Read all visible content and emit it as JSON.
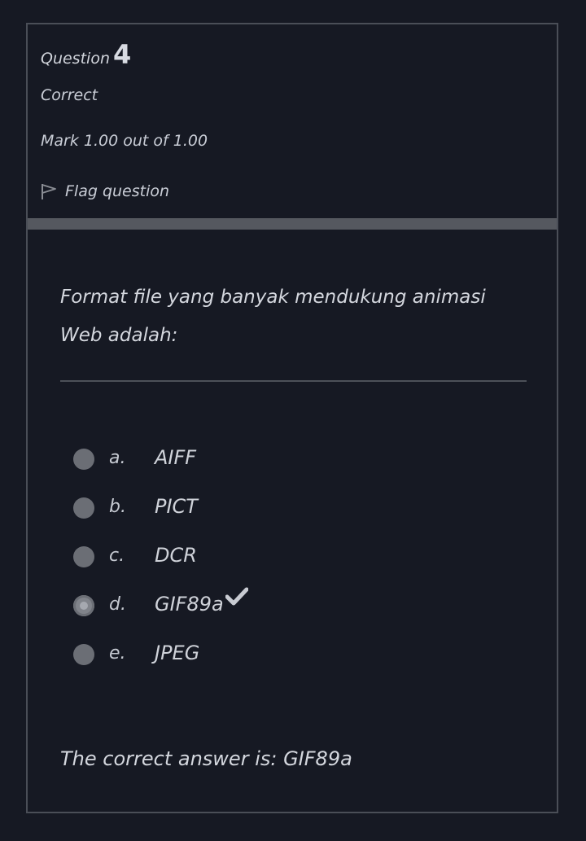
{
  "question": {
    "label": "Question",
    "number": "4",
    "state": "Correct",
    "grade": "Mark 1.00 out of 1.00",
    "flag_label": "Flag question",
    "text": "Format file yang banyak mendukung animasi Web adalah:"
  },
  "options": [
    {
      "letter": "a.",
      "text": "AIFF",
      "selected": false
    },
    {
      "letter": "b.",
      "text": "PICT",
      "selected": false
    },
    {
      "letter": "c.",
      "text": "DCR",
      "selected": false
    },
    {
      "letter": "d.",
      "text": "GIF89a",
      "selected": true,
      "correct_icon": "check-icon"
    },
    {
      "letter": "e.",
      "text": "JPEG",
      "selected": false
    }
  ],
  "feedback": {
    "right_answer": "The correct answer is: GIF89a"
  },
  "colors": {
    "background": "#161923",
    "border": "#4a4e57",
    "divider": "#55585f",
    "text": "#c9cdd6",
    "radio": "#6b6e75"
  }
}
